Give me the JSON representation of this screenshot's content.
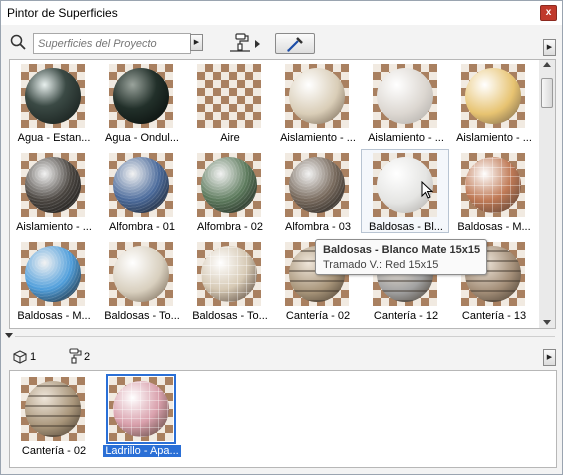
{
  "window": {
    "title": "Pintor de Superficies",
    "close_glyph": "x"
  },
  "toolbar": {
    "search_placeholder": "Superficies del Proyecto",
    "search_icon": "search-icon",
    "brush_icon": "paint-roller-icon",
    "eyedropper_icon": "eyedropper-icon"
  },
  "grid": {
    "tiles": [
      {
        "label": "Agua - Estan...",
        "color": "#3b4a45",
        "style": "glass"
      },
      {
        "label": "Agua - Ondul...",
        "color": "#22302a",
        "style": "dark"
      },
      {
        "label": "Aire",
        "color": "",
        "style": "none"
      },
      {
        "label": "Aislamiento - ...",
        "color": "#d9cdb7",
        "style": "plain"
      },
      {
        "label": "Aislamiento - ...",
        "color": "#dcd7d1",
        "style": "pale"
      },
      {
        "label": "Aislamiento - ...",
        "color": "#e7c371",
        "style": "plain"
      },
      {
        "label": "Aislamiento - ...",
        "color": "#4a4540",
        "style": "rough"
      },
      {
        "label": "Alfombra - 01",
        "color": "#4a6a9b",
        "style": "rough"
      },
      {
        "label": "Alfombra - 02",
        "color": "#5c7a5c",
        "style": "rough"
      },
      {
        "label": "Alfombra - 03",
        "color": "#77695c",
        "style": "rough"
      },
      {
        "label": "Baldosas - Bl...",
        "color": "#e5e5e3",
        "style": "pale"
      },
      {
        "label": "Baldosas - M...",
        "color": "#c07a56",
        "style": "tile"
      },
      {
        "label": "Baldosas - M...",
        "color": "#4f9edb",
        "style": "rough"
      },
      {
        "label": "Baldosas - To...",
        "color": "#d8cfbe",
        "style": "plain"
      },
      {
        "label": "Baldosas - To...",
        "color": "#d6c9b4",
        "style": "tile"
      },
      {
        "label": "Cantería - 02",
        "color": "#a8957a",
        "style": "stone"
      },
      {
        "label": "Cantería - 12",
        "color": "#a2a2a2",
        "style": "stone"
      },
      {
        "label": "Cantería - 13",
        "color": "#a38e78",
        "style": "stone"
      }
    ],
    "tooltip": {
      "title": "Baldosas - Blanco Mate 15x15",
      "detail": "Tramado V.: Red 15x15"
    }
  },
  "status": {
    "surfaces_count": "1",
    "brushes_count": "2"
  },
  "selection": {
    "tiles": [
      {
        "label": "Cantería - 02",
        "color": "#a8957a",
        "style": "stone",
        "selected": false
      },
      {
        "label": "Ladrillo - Apa...",
        "color": "#d9a0ac",
        "style": "tile",
        "selected": true
      }
    ]
  }
}
